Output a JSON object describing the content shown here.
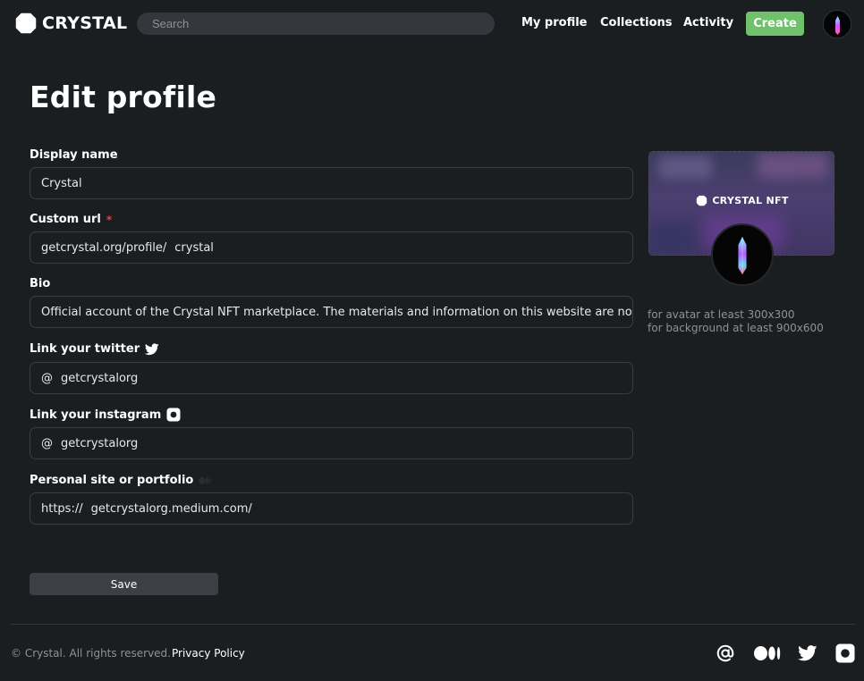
{
  "header": {
    "brand": "CRYSTAL",
    "search_placeholder": "Search",
    "nav": [
      "My profile",
      "Collections",
      "Activity"
    ],
    "create_label": "Create"
  },
  "page": {
    "title": "Edit profile"
  },
  "form": {
    "display_name": {
      "label": "Display name",
      "value": "Crystal"
    },
    "custom_url": {
      "label": "Custom url",
      "required_mark": "*",
      "prefix": "getcrystal.org/profile/",
      "value": "crystal"
    },
    "bio": {
      "label": "Bio",
      "value": "Official account of the Crystal NFT marketplace. The materials and information on this website are not relat"
    },
    "twitter": {
      "label": "Link your twitter",
      "prefix": "@",
      "value": "getcrystalorg"
    },
    "instagram": {
      "label": "Link your instagram",
      "prefix": "@",
      "value": "getcrystalorg"
    },
    "site": {
      "label": "Personal site or portfolio",
      "prefix": "https://",
      "value": "getcrystalorg.medium.com/"
    },
    "save_label": "Save"
  },
  "preview": {
    "cover_brand": "CRYSTAL NFT",
    "hint_avatar": "for avatar at least 300x300",
    "hint_background": "for background at least 900x600"
  },
  "footer": {
    "copyright": "© Crystal. All rights reserved.",
    "privacy": "Privacy Policy",
    "social_icons": [
      "at-icon",
      "medium-icon",
      "twitter-icon",
      "instagram-icon"
    ]
  },
  "colors": {
    "background": "#1b1e21",
    "accent_create": "#6fc26b",
    "required": "#e0443e",
    "muted_text": "#8e9196",
    "field_border": "#3a3d42"
  }
}
